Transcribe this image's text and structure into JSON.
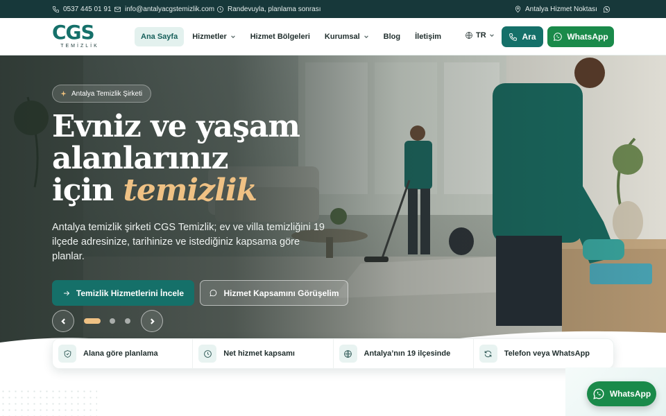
{
  "topbar": {
    "phone": "0537 445 01 91",
    "email": "info@antalyacgstemizlik.com",
    "hours": "Randevuyla, planlama sonrası",
    "location": "Antalya Hizmet Noktası"
  },
  "brand": {
    "name": "CGS",
    "tagline": "TEMİZLİK"
  },
  "nav": {
    "items": [
      {
        "label": "Ana Sayfa",
        "active": true,
        "dropdown": false
      },
      {
        "label": "Hizmetler",
        "active": false,
        "dropdown": true
      },
      {
        "label": "Hizmet Bölgeleri",
        "active": false,
        "dropdown": false
      },
      {
        "label": "Kurumsal",
        "active": false,
        "dropdown": true
      },
      {
        "label": "Blog",
        "active": false,
        "dropdown": false
      },
      {
        "label": "İletişim",
        "active": false,
        "dropdown": false
      }
    ],
    "language": "TR",
    "call_label": "Ara",
    "whatsapp_label": "WhatsApp"
  },
  "hero": {
    "badge": "Antalya Temizlik Şirketi",
    "headline_line1": "Evniz ve yaşam",
    "headline_line2": "alanlarınız",
    "headline_line3_prefix": "için",
    "headline_accent": "temizlik",
    "lead": "Antalya temizlik şirketi CGS Temizlik; ev ve villa temizliğini 19 ilçede adresinize, tarihinize ve istediğiniz kapsama göre planlar.",
    "primary_cta": "Temizlik Hizmetlerini İncele",
    "secondary_cta": "Hizmet Kapsamını Görüşelim",
    "slides_total": 3,
    "slide_active": 1
  },
  "features": [
    {
      "icon": "shield-icon",
      "label": "Alana göre planlama"
    },
    {
      "icon": "clock-icon",
      "label": "Net hizmet kapsamı"
    },
    {
      "icon": "globe-icon",
      "label": "Antalya’nın 19 ilçesinde"
    },
    {
      "icon": "refresh-icon",
      "label": "Telefon veya WhatsApp"
    }
  ],
  "floating_whatsapp": "WhatsApp",
  "colors": {
    "primary": "#157069",
    "whatsapp": "#1a8a4a",
    "accent": "#efc184",
    "topbar": "#17383a"
  }
}
